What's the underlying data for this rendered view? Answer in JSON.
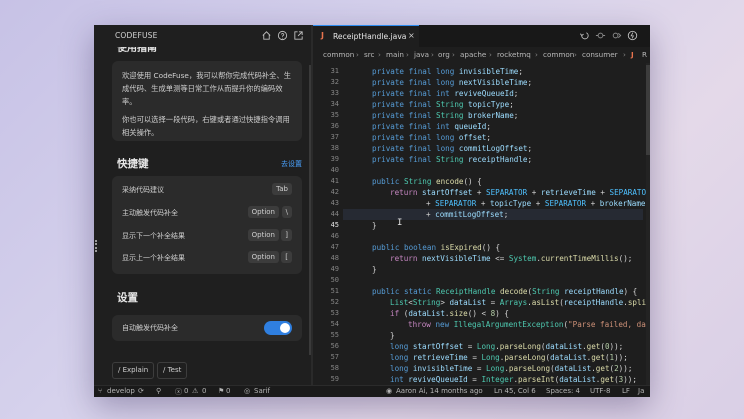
{
  "panel": {
    "brand": "CODEFUSE",
    "guide_title": "使用指南",
    "guide_p1": "欢迎使用 CodeFuse，我可以帮你完成代码补全、生成代码、生成单测等日常工作从而提升你的编码效率。",
    "guide_p2": "你也可以选择一段代码，右键或者通过快捷指令调用相关操作。",
    "shortcuts_title": "快捷键",
    "shortcuts_link": "去设置",
    "shortcuts": [
      {
        "label": "采纳代码建议",
        "keys": [
          "Tab"
        ]
      },
      {
        "label": "主动触发代码补全",
        "keys": [
          "Option",
          "\\"
        ]
      },
      {
        "label": "显示下一个补全结果",
        "keys": [
          "Option",
          "]"
        ]
      },
      {
        "label": "显示上一个补全结果",
        "keys": [
          "Option",
          "["
        ]
      }
    ],
    "settings_title": "设置",
    "auto_complete_label": "自动触发代码补全",
    "auto_complete_enabled": true,
    "chips": [
      "/ Explain",
      "/ Test"
    ]
  },
  "editor": {
    "tab_icon": "J",
    "tab_title": "ReceiptHandle.java",
    "close": "×",
    "breadcrumbs": [
      "common",
      "src",
      "main",
      "java",
      "org",
      "apache",
      "rocketmq",
      "common",
      "consumer",
      "J",
      "R"
    ],
    "line_numbers": [
      "31",
      "32",
      "33",
      "34",
      "35",
      "36",
      "37",
      "38",
      "39",
      "40",
      "41",
      "42",
      "43",
      "44",
      "45",
      "46",
      "47",
      "48",
      "49",
      "50",
      "51",
      "52",
      "53",
      "54",
      "55",
      "56",
      "57",
      "58",
      "59"
    ],
    "active_line": "45"
  },
  "status": {
    "branch": "develop",
    "errors": "0",
    "warnings": "0",
    "ports": "0",
    "user": "Sarif",
    "blame": "Aaron Ai, 14 months ago",
    "position": "Ln 45, Col 6",
    "spaces": "Spaces: 4",
    "encoding": "UTF-8",
    "eol": "LF",
    "lang": "Ja"
  },
  "colors": {
    "accent": "#2f7fe0",
    "keyword": "#569cd6",
    "type": "#4ec9b0",
    "method": "#dcdcaa",
    "variable": "#9cdcfe",
    "string": "#ce9178",
    "number": "#b5cea8"
  },
  "icons": [
    "home-icon",
    "help-icon",
    "open-external-icon",
    "java-file-icon",
    "back-icon",
    "forward-icon",
    "split-icon",
    "cursor-icon",
    "branch-icon",
    "sync-icon",
    "error-icon",
    "warning-icon",
    "port-icon",
    "user-icon"
  ]
}
